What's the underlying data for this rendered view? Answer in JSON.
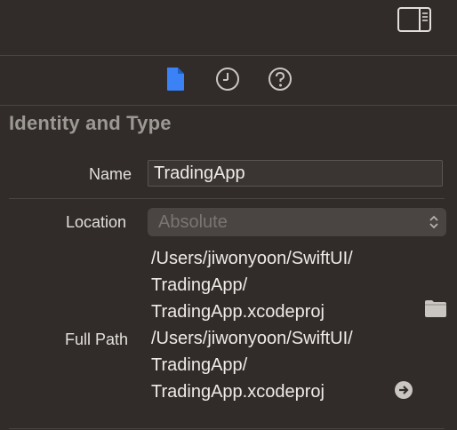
{
  "topbar": {
    "toggle_icon": "inspector-panel-toggle-icon"
  },
  "tabs": [
    {
      "icon": "file-inspector-icon",
      "selected": true
    },
    {
      "icon": "history-inspector-icon",
      "selected": false
    },
    {
      "icon": "quick-help-icon",
      "selected": false
    }
  ],
  "identity": {
    "section_title": "Identity and Type",
    "name_label": "Name",
    "name_value": "TradingApp",
    "location_label": "Location",
    "location_value": "Absolute",
    "location_path_lines": [
      "/Users/jiwonyoon/SwiftUI/",
      "TradingApp/",
      "TradingApp.xcodeproj"
    ],
    "full_path_label": "Full Path",
    "full_path_lines": [
      "/Users/jiwonyoon/SwiftUI/",
      "TradingApp/",
      "TradingApp.xcodeproj"
    ]
  },
  "colors": {
    "background": "#312c2a",
    "accent": "#3b82f6",
    "muted_text": "#9c9894"
  }
}
